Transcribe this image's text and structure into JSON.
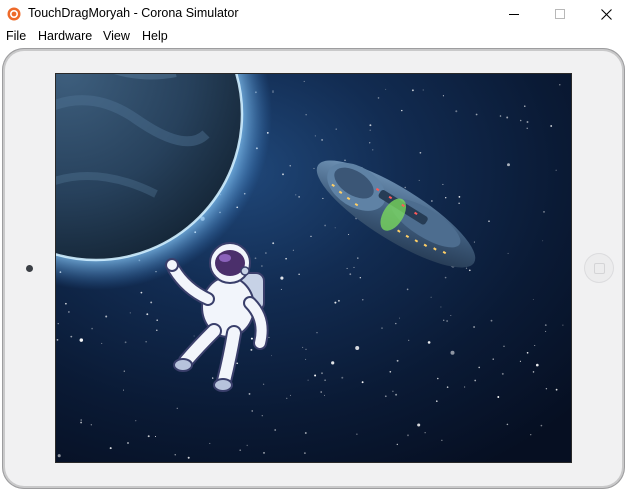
{
  "window": {
    "title": "TouchDragMoryah - Corona Simulator",
    "app_icon": "corona-icon",
    "controls": [
      "minimize-icon",
      "maximize-icon",
      "close-icon"
    ]
  },
  "menu": {
    "items": [
      {
        "label": "File"
      },
      {
        "label": "Hardware"
      },
      {
        "label": "View"
      },
      {
        "label": "Help"
      }
    ]
  },
  "simulator": {
    "device": "tablet-landscape",
    "scene": {
      "background": "space-starfield",
      "objects": [
        "planet",
        "astronaut-sprite",
        "spaceship-sprite"
      ]
    }
  },
  "colors": {
    "space_dark": "#0b1a33",
    "planet_glow": "#8fd0ff",
    "device_bezel": "#f1f1f2",
    "corona_orange": "#ee6a2a"
  }
}
